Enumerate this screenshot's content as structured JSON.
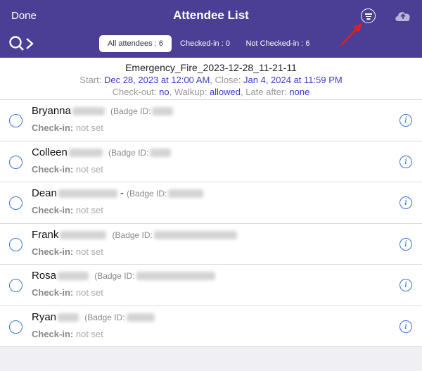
{
  "header": {
    "done_label": "Done",
    "title": "Attendee List"
  },
  "tabs": [
    {
      "label": "All attendees : 6",
      "active": true
    },
    {
      "label": "Checked-in : 0",
      "active": false
    },
    {
      "label": "Not Checked-in : 6",
      "active": false
    }
  ],
  "event": {
    "name": "Emergency_Fire_2023-12-28_11-21-11",
    "start_label": "Start:",
    "start_value": "Dec 28, 2023 at 12:00 AM",
    "close_label": ", Close:",
    "close_value": "Jan 4, 2024 at 11:59 PM",
    "checkout_label": "Check-out:",
    "checkout_value": "no",
    "walkup_label": ", Walkup:",
    "walkup_value": "allowed",
    "late_label": ", Late after:",
    "late_value": "none"
  },
  "attendees": [
    {
      "first": "Bryanna",
      "badge_label": "(Badge ID:",
      "checkin_label": "Check-in:",
      "checkin_value": "not set"
    },
    {
      "first": "Colleen",
      "badge_label": "(Badge ID:",
      "checkin_label": "Check-in:",
      "checkin_value": "not set"
    },
    {
      "first": "Dean",
      "suffix": "-",
      "badge_label": "(Badge ID:",
      "checkin_label": "Check-in:",
      "checkin_value": "not set"
    },
    {
      "first": "Frank",
      "badge_label": "(Badge ID:",
      "checkin_label": "Check-in:",
      "checkin_value": "not set"
    },
    {
      "first": "Rosa",
      "badge_label": "(Badge ID:",
      "checkin_label": "Check-in:",
      "checkin_value": "not set"
    },
    {
      "first": "Ryan",
      "badge_label": "(Badge ID:",
      "checkin_label": "Check-in:",
      "checkin_value": "not set"
    }
  ],
  "colors": {
    "header_bg": "#4a3f95",
    "accent_blue": "#3b73d6",
    "annotation_arrow": "#e02020"
  },
  "icons": {
    "search": "search-icon",
    "filter": "filter-icon",
    "cloud": "cloud-upload-icon",
    "info": "info-icon",
    "radio": "radio-unchecked-icon"
  }
}
